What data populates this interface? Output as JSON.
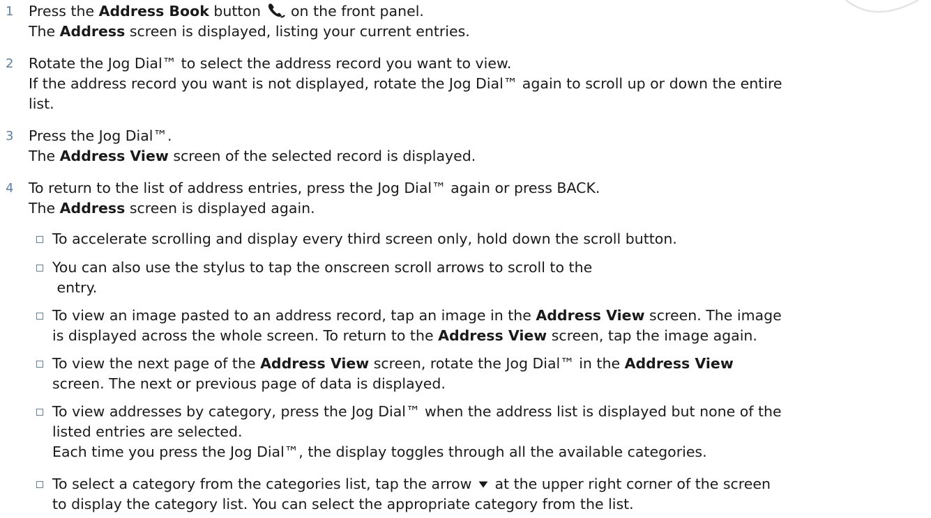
{
  "steps": [
    {
      "number": "1",
      "line1": [
        "Press the ",
        "Address Book",
        " button ",
        " on the front panel."
      ],
      "line2": [
        "The ",
        "Address",
        " screen is displayed, listing your current entries."
      ]
    },
    {
      "number": "2",
      "line1": "Rotate the Jog Dial™ to select the address record you want to view.",
      "line2": "If the address record you want is not displayed, rotate the Jog Dial™ again to scroll up or down the entire",
      "line3": "list."
    },
    {
      "number": "3",
      "line1": "Press the Jog Dial™.",
      "line2": [
        "The ",
        "Address View",
        " screen of the selected record is displayed."
      ]
    },
    {
      "number": "4",
      "line1": "To return to the list of address entries, press the Jog Dial™ again or press BACK.",
      "line2": [
        "The ",
        "Address",
        " screen is displayed again."
      ]
    }
  ],
  "bullets": [
    {
      "line1": "To accelerate scrolling and display every third screen only, hold down the scroll button."
    },
    {
      "line1": "You can also use the stylus to tap the onscreen scroll arrows to scroll to the",
      "line2": " entry."
    },
    {
      "line1": [
        "To view an image pasted to an address record, tap an image in the ",
        "Address View",
        " screen. The image"
      ],
      "line2": [
        "is displayed across the whole screen. To return to the ",
        "Address View",
        " screen, tap the image again."
      ]
    },
    {
      "line1": [
        "To view the next page of the ",
        "Address View",
        " screen, rotate the Jog Dial™ in the ",
        "Address View"
      ],
      "line2": "screen. The next or previous page of data is displayed."
    },
    {
      "line1": "To view addresses by category, press the Jog Dial™ when the address list is displayed but none of the",
      "line2": "listed entries are selected.",
      "line3": "Each time you press the Jog Dial™, the display toggles through all the available categories."
    },
    {
      "line1": [
        "To select a category from the categories list, tap the arrow ",
        " at the upper right corner of the screen"
      ],
      "line2": "to display the category list. You can select the appropriate category from the list."
    }
  ],
  "icons": {
    "address_book_button": "phone-icon",
    "category_arrow": "down-arrow-icon"
  },
  "colors": {
    "step_number": "#5a7fa8",
    "bullet_box": "#5a7fa8",
    "text": "#1a1a1a"
  }
}
